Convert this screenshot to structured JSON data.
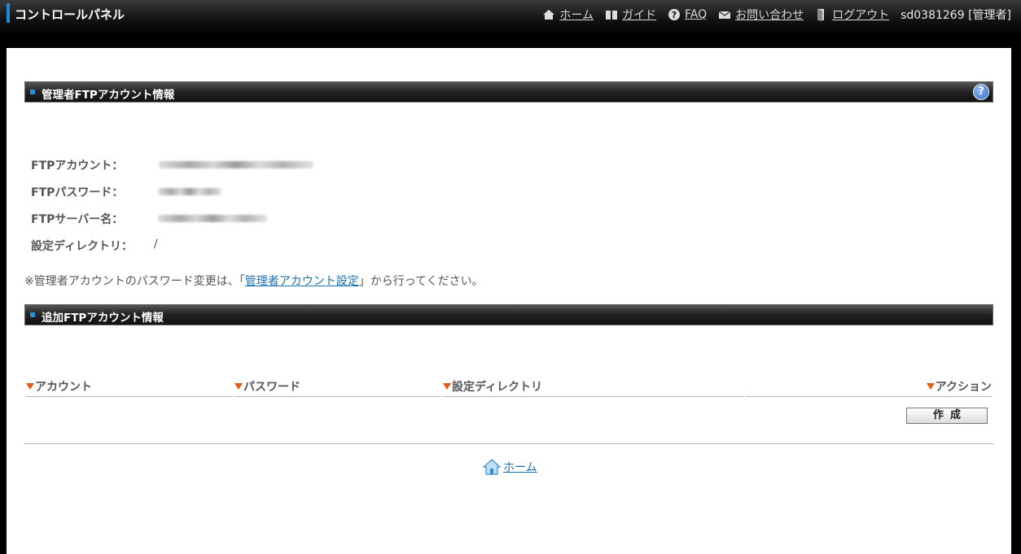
{
  "app": {
    "title": "コントロールパネル"
  },
  "nav": {
    "home": "ホーム",
    "guide": "ガイド",
    "faq": "FAQ",
    "contact": "お問い合わせ",
    "logout": "ログアウト",
    "user": "sd0381269 [管理者]"
  },
  "admin_section": {
    "title": "管理者FTPアカウント情報",
    "help": "?",
    "rows": [
      {
        "label": "FTPアカウント："
      },
      {
        "label": "FTPパスワード："
      },
      {
        "label": "FTPサーバー名："
      },
      {
        "label": "設定ディレクトリ：",
        "value": "/"
      }
    ],
    "note_prefix": "※管理者アカウントのパスワード変更は、「",
    "note_link": "管理者アカウント設定",
    "note_suffix": "」から行ってください。"
  },
  "additional_section": {
    "title": "追加FTPアカウント情報",
    "columns": [
      "アカウント",
      "パスワード",
      "設定ディレクトリ",
      "アクション"
    ],
    "create_button": "作成"
  },
  "footer": {
    "home_link": "ホーム"
  },
  "colors": {
    "accent": "#1e8bd8",
    "sort_arrow": "#e25a14",
    "link": "#1a6fb0"
  }
}
